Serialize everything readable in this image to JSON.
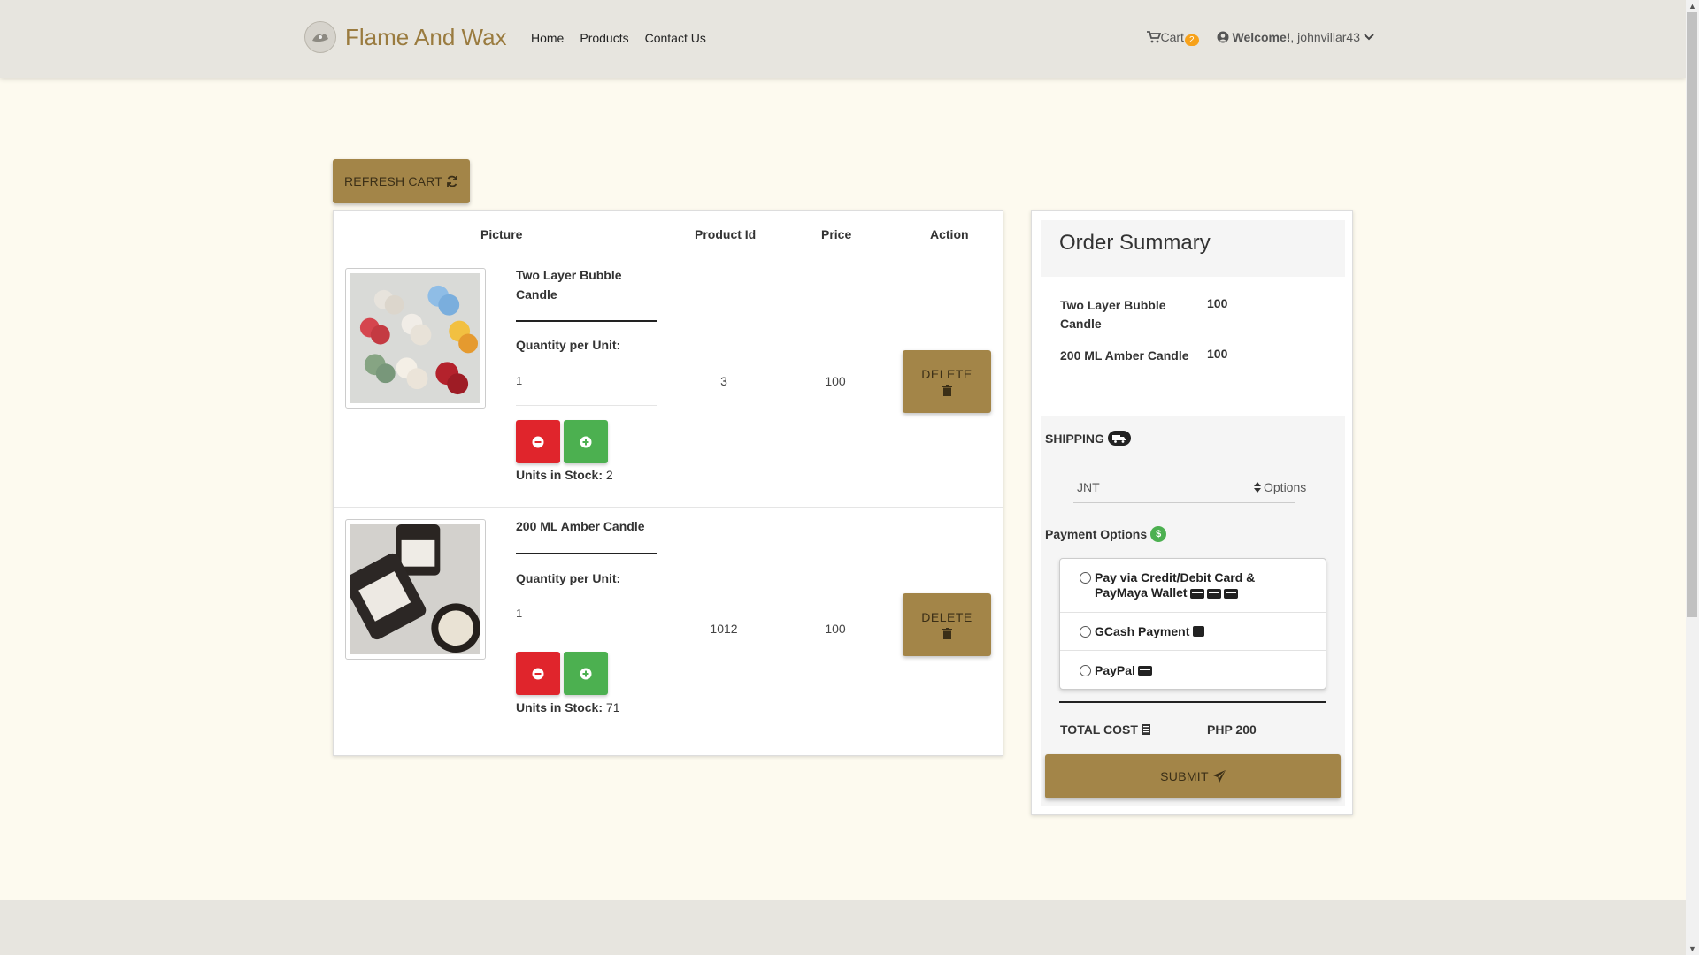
{
  "brand": {
    "name": "Flame And Wax"
  },
  "nav": {
    "links": [
      "Home",
      "Products",
      "Contact Us"
    ]
  },
  "header_right": {
    "cart_label": "Cart",
    "cart_count": "2",
    "welcome": "Welcome!",
    "username": ", johnvillar43"
  },
  "toolbar": {
    "refresh_label": "REFRESH CART"
  },
  "table": {
    "headers": [
      "Picture",
      "Product Id",
      "Price",
      "Action"
    ],
    "qty_label": "Quantity per Unit:",
    "stock_label": "Units in Stock:",
    "delete_label": "DELETE",
    "rows": [
      {
        "name": "Two Layer Bubble Candle",
        "quantity": "1",
        "product_id": "3",
        "price": "100",
        "stock": "2"
      },
      {
        "name": "200 ML Amber Candle",
        "quantity": "1",
        "product_id": "1012",
        "price": "100",
        "stock": "71"
      }
    ]
  },
  "summary": {
    "title": "Order Summary",
    "items": [
      {
        "name": "Two Layer Bubble Candle",
        "price": "100"
      },
      {
        "name": "200 ML Amber Candle",
        "price": "100"
      }
    ],
    "shipping_label": "SHIPPING",
    "shipping_value": "JNT",
    "shipping_options": "Options",
    "payment_label": "Payment Options",
    "payment_options": [
      "Pay via Credit/Debit Card & PayMaya Wallet",
      "GCash Payment",
      "PayPal"
    ],
    "total_label": "TOTAL COST",
    "total_value": "PHP 200",
    "submit_label": "SUBMIT"
  },
  "colors": {
    "accent": "#a38548",
    "danger": "#e0252c",
    "success": "#4cb050",
    "badge": "#f7a21b",
    "background": "#fdfaef"
  }
}
